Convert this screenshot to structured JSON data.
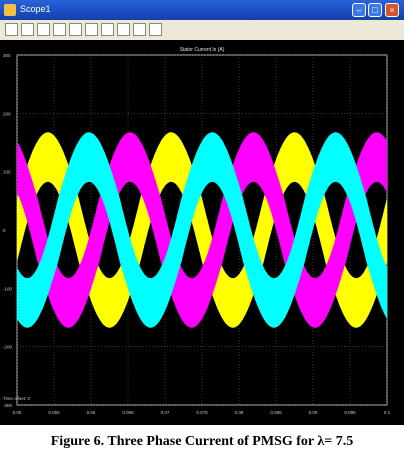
{
  "window": {
    "title": "Scope1",
    "plot_title": "Stator Current Is (A)",
    "offset_label": "Time offset: 0"
  },
  "caption": "Figure 6. Three Phase Current of PMSG for λ= 7.5",
  "colors": {
    "phase_a": "#ffff00",
    "phase_b": "#ff00ff",
    "phase_c": "#00ffff",
    "background": "#000000",
    "axes": "#ffffff"
  },
  "toolbar_icons": [
    "print-icon",
    "parameters-icon",
    "zoom-icon",
    "zoom-x-icon",
    "zoom-y-icon",
    "autoscale-icon",
    "save-axes-icon",
    "restore-axes-icon",
    "floating-scope-icon",
    "signal-selector-icon"
  ],
  "chart_data": {
    "type": "line",
    "title": "Stator Current Is (A)",
    "xlabel": "",
    "ylabel": "",
    "xlim": [
      0.0,
      0.1
    ],
    "ylim": [
      -300,
      300
    ],
    "xticks": [
      "0.05",
      "0.055",
      "0.06",
      "0.065",
      "0.07",
      "0.075",
      "0.08",
      "0.085",
      "0.09",
      "0.095",
      "0.1"
    ],
    "yticks": [
      "300",
      "200",
      "100",
      "0",
      "-100",
      "-200",
      "-300"
    ],
    "grid": true,
    "legend": "none",
    "series": [
      {
        "amplitude": 125,
        "band": [
          35,
          105
        ],
        "phase_deg": 0,
        "color": "#ffff00"
      },
      {
        "amplitude": 125,
        "band": [
          35,
          105
        ],
        "phase_deg": 120,
        "color": "#ff00ff"
      },
      {
        "amplitude": 125,
        "band": [
          35,
          105
        ],
        "phase_deg": 240,
        "color": "#00ffff"
      }
    ],
    "cycles_shown": 3
  }
}
